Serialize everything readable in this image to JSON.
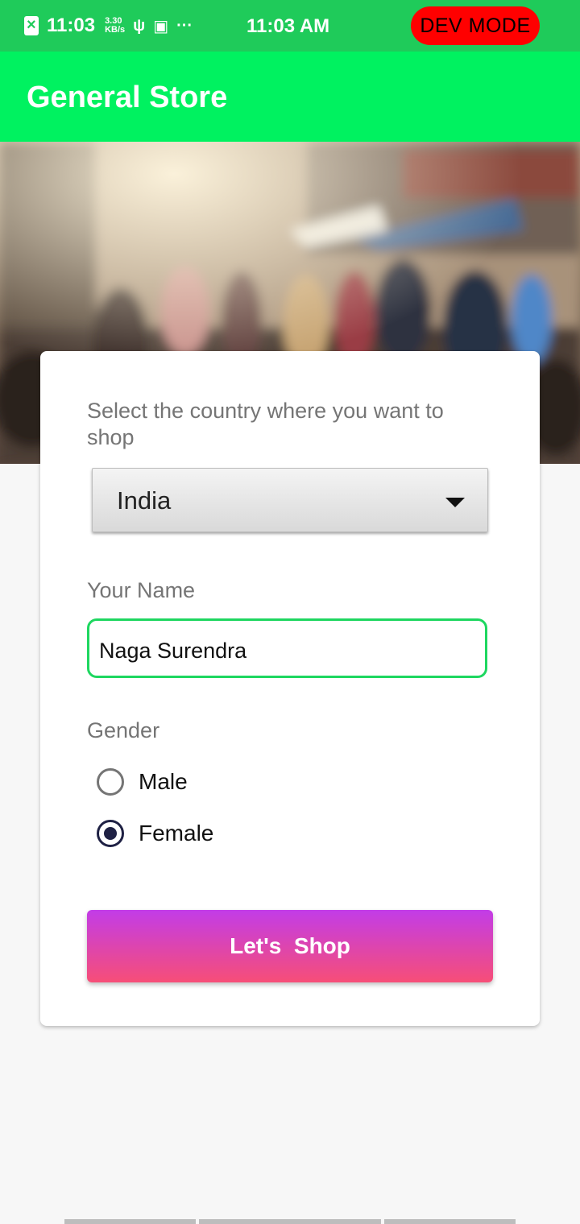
{
  "status_bar": {
    "time_left": "11:03",
    "speed_value": "3.30",
    "speed_unit": "KB/s",
    "more": "···",
    "time_center": "11:03 AM",
    "dev_mode": "DEV MODE"
  },
  "app_bar": {
    "title": "General Store"
  },
  "form": {
    "country_label": "Select the country where you want to shop",
    "country_value": "India",
    "name_label": "Your Name",
    "name_value": "Naga Surendra",
    "gender_label": "Gender",
    "gender_options": [
      {
        "label": "Male",
        "checked": false
      },
      {
        "label": "Female",
        "checked": true
      }
    ],
    "shop_button": "Let's  Shop"
  },
  "colors": {
    "status_bar": "#1fcb5a",
    "app_bar": "#00f260",
    "input_border": "#1ed760",
    "button_top": "#c23ce8",
    "button_bottom": "#f74e77",
    "dev_badge": "#ff0000"
  }
}
